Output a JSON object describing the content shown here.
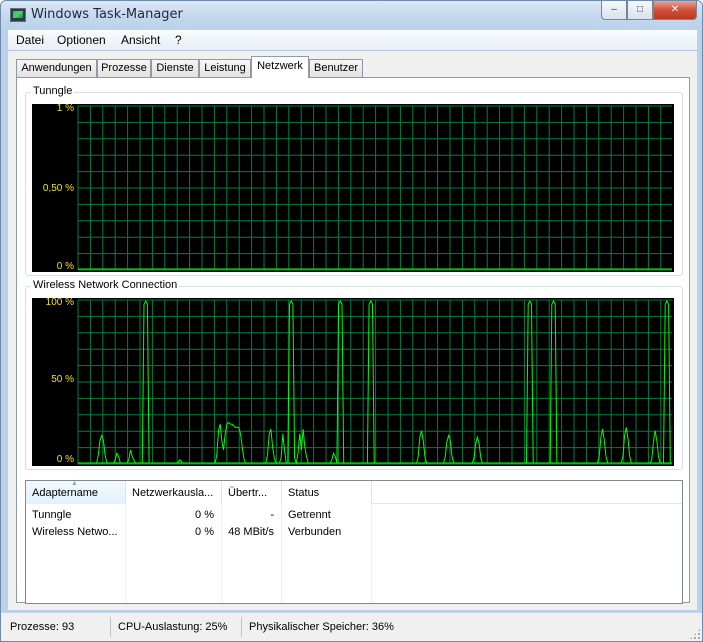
{
  "window": {
    "title": "Windows Task-Manager",
    "buttons": {
      "minimize": "–",
      "maximize": "□",
      "close": "✕"
    }
  },
  "menu": [
    "Datei",
    "Optionen",
    "Ansicht",
    "?"
  ],
  "tabs": [
    "Anwendungen",
    "Prozesse",
    "Dienste",
    "Leistung",
    "Netzwerk",
    "Benutzer"
  ],
  "active_tab": "Netzwerk",
  "graphs": [
    {
      "title": "Tunngle",
      "ticks": [
        "1 %",
        "0,50 %",
        "0 %"
      ],
      "line_color": "#00ff00",
      "grid_color": "#008040",
      "values": []
    },
    {
      "title": "Wireless Network Connection",
      "ticks": [
        "100 %",
        "50 %",
        "0 %"
      ],
      "line_color": "#00ff00",
      "grid_color": "#008040",
      "values": [
        0,
        0,
        0,
        0,
        0,
        0,
        0,
        0,
        0,
        0,
        0,
        0,
        5,
        14,
        17,
        14,
        5,
        0,
        0,
        0,
        0,
        0,
        2,
        6,
        4,
        0,
        0,
        0,
        0,
        0,
        2,
        8,
        4,
        2,
        0,
        0,
        0,
        0,
        0,
        98,
        100,
        98,
        0,
        0,
        0,
        0,
        0,
        0,
        0,
        0,
        0,
        0,
        0,
        0,
        0,
        0,
        0,
        0,
        0,
        0,
        2,
        1,
        0,
        0,
        0,
        0,
        0,
        0,
        0,
        0,
        0,
        0,
        0,
        0,
        0,
        0,
        0,
        0,
        0,
        0,
        0,
        0,
        5,
        20,
        24,
        14,
        8,
        18,
        24,
        25,
        24,
        24,
        23,
        22,
        22,
        22,
        18,
        10,
        3,
        0,
        0,
        0,
        0,
        0,
        0,
        0,
        0,
        0,
        0,
        0,
        0,
        0,
        5,
        18,
        21,
        10,
        3,
        0,
        0,
        0,
        3,
        18,
        8,
        0,
        0,
        98,
        100,
        98,
        3,
        0,
        6,
        18,
        8,
        21,
        10,
        4,
        0,
        0,
        0,
        0,
        0,
        0,
        0,
        0,
        0,
        0,
        0,
        0,
        0,
        0,
        2,
        6,
        4,
        0,
        98,
        100,
        98,
        0,
        0,
        0,
        0,
        0,
        0,
        0,
        0,
        0,
        0,
        0,
        0,
        0,
        0,
        0,
        98,
        100,
        98,
        0,
        0,
        0,
        0,
        0,
        0,
        0,
        0,
        0,
        0,
        0,
        0,
        0,
        0,
        0,
        0,
        0,
        0,
        0,
        0,
        0,
        0,
        0,
        0,
        0,
        0,
        4,
        16,
        20,
        14,
        4,
        0,
        0,
        0,
        0,
        0,
        0,
        0,
        0,
        0,
        0,
        0,
        4,
        13,
        17,
        14,
        4,
        0,
        0,
        0,
        0,
        0,
        0,
        0,
        0,
        0,
        0,
        0,
        0,
        3,
        12,
        16,
        12,
        3,
        0,
        0,
        0,
        0,
        0,
        0,
        0,
        0,
        0,
        0,
        0,
        0,
        0,
        0,
        0,
        0,
        0,
        0,
        0,
        0,
        0,
        0,
        0,
        0,
        0,
        0,
        0,
        98,
        100,
        98,
        0,
        0,
        0,
        0,
        0,
        0,
        0,
        0,
        0,
        0,
        0,
        98,
        100,
        98,
        0,
        0,
        0,
        0,
        0,
        0,
        0,
        0,
        0,
        0,
        0,
        0,
        0,
        0,
        0,
        0,
        0,
        0,
        0,
        0,
        0,
        0,
        0,
        0,
        0,
        4,
        16,
        21,
        14,
        4,
        0,
        0,
        0,
        0,
        0,
        0,
        0,
        0,
        0,
        4,
        17,
        22,
        15,
        4,
        0,
        0,
        0,
        0,
        0,
        0,
        0,
        0,
        0,
        0,
        0,
        0,
        2,
        13,
        20,
        14,
        4,
        0,
        0,
        0,
        98,
        100,
        98,
        0,
        0
      ]
    }
  ],
  "adapter_table": {
    "columns": [
      "Adaptername",
      "Netzwerkausla...",
      "Übertr...",
      "Status"
    ],
    "rows": [
      {
        "name": "Tunngle",
        "usage": "0 %",
        "speed": "-",
        "status": "Getrennt"
      },
      {
        "name": "Wireless Netwo...",
        "usage": "0 %",
        "speed": "48 MBit/s",
        "status": "Verbunden"
      }
    ]
  },
  "status_bar": {
    "processes": "Prozesse: 93",
    "cpu": "CPU-Auslastung: 25%",
    "memory": "Physikalischer Speicher: 36%"
  }
}
